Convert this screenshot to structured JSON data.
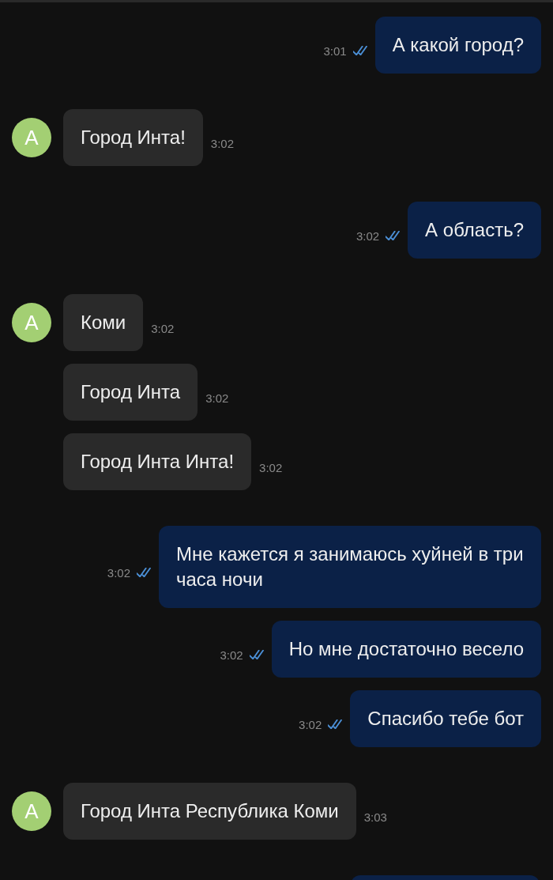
{
  "groups": [
    {
      "kind": "me",
      "messages": [
        {
          "text": "А какой город?",
          "time": "3:01",
          "read": true
        }
      ]
    },
    {
      "kind": "bot",
      "avatar": "А",
      "messages": [
        {
          "text": "Город Инта!",
          "time": "3:02"
        }
      ]
    },
    {
      "kind": "me",
      "messages": [
        {
          "text": "А область?",
          "time": "3:02",
          "read": true
        }
      ]
    },
    {
      "kind": "bot",
      "avatar": "А",
      "messages": [
        {
          "text": "Коми",
          "time": "3:02"
        },
        {
          "text": "Город Инта",
          "time": "3:02"
        },
        {
          "text": "Город Инта Инта!",
          "time": "3:02"
        }
      ]
    },
    {
      "kind": "me",
      "messages": [
        {
          "text": "Мне кажется я занимаюсь хуйней в три часа ночи",
          "time": "3:02",
          "read": true
        },
        {
          "text": "Но мне достаточно весело",
          "time": "3:02",
          "read": true
        },
        {
          "text": "Спасибо тебе бот",
          "time": "3:02",
          "read": true
        }
      ]
    },
    {
      "kind": "bot",
      "avatar": "А",
      "messages": [
        {
          "text": "Город Инта Республика Коми",
          "time": "3:03"
        }
      ]
    },
    {
      "kind": "me",
      "messages": [
        {
          "kind": "cut-off"
        }
      ]
    }
  ]
}
